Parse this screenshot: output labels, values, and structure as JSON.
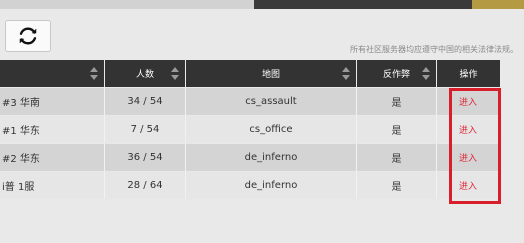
{
  "notice": "所有社区服务器均应遵守中国的相关法律法规。",
  "columns": {
    "name": "",
    "players": "人数",
    "map": "地图",
    "anticheat": "反作弊",
    "action": "操作"
  },
  "rows": [
    {
      "name": "#3 华南",
      "players": "34 / 54",
      "map": "cs_assault",
      "anticheat": "是",
      "action": "进入"
    },
    {
      "name": "#1 华东",
      "players": "7 / 54",
      "map": "cs_office",
      "anticheat": "是",
      "action": "进入"
    },
    {
      "name": "#2 华东",
      "players": "36 / 54",
      "map": "de_inferno",
      "anticheat": "是",
      "action": "进入"
    },
    {
      "name": "i普 1服",
      "players": "28 / 64",
      "map": "de_inferno",
      "anticheat": "是",
      "action": "进入"
    }
  ],
  "colors": {
    "header_bg": "#333333",
    "accent_red": "#e0283a",
    "highlight_border": "#d81e2a"
  },
  "icons": {
    "refresh": "refresh-icon",
    "sort": "sort-icon"
  }
}
